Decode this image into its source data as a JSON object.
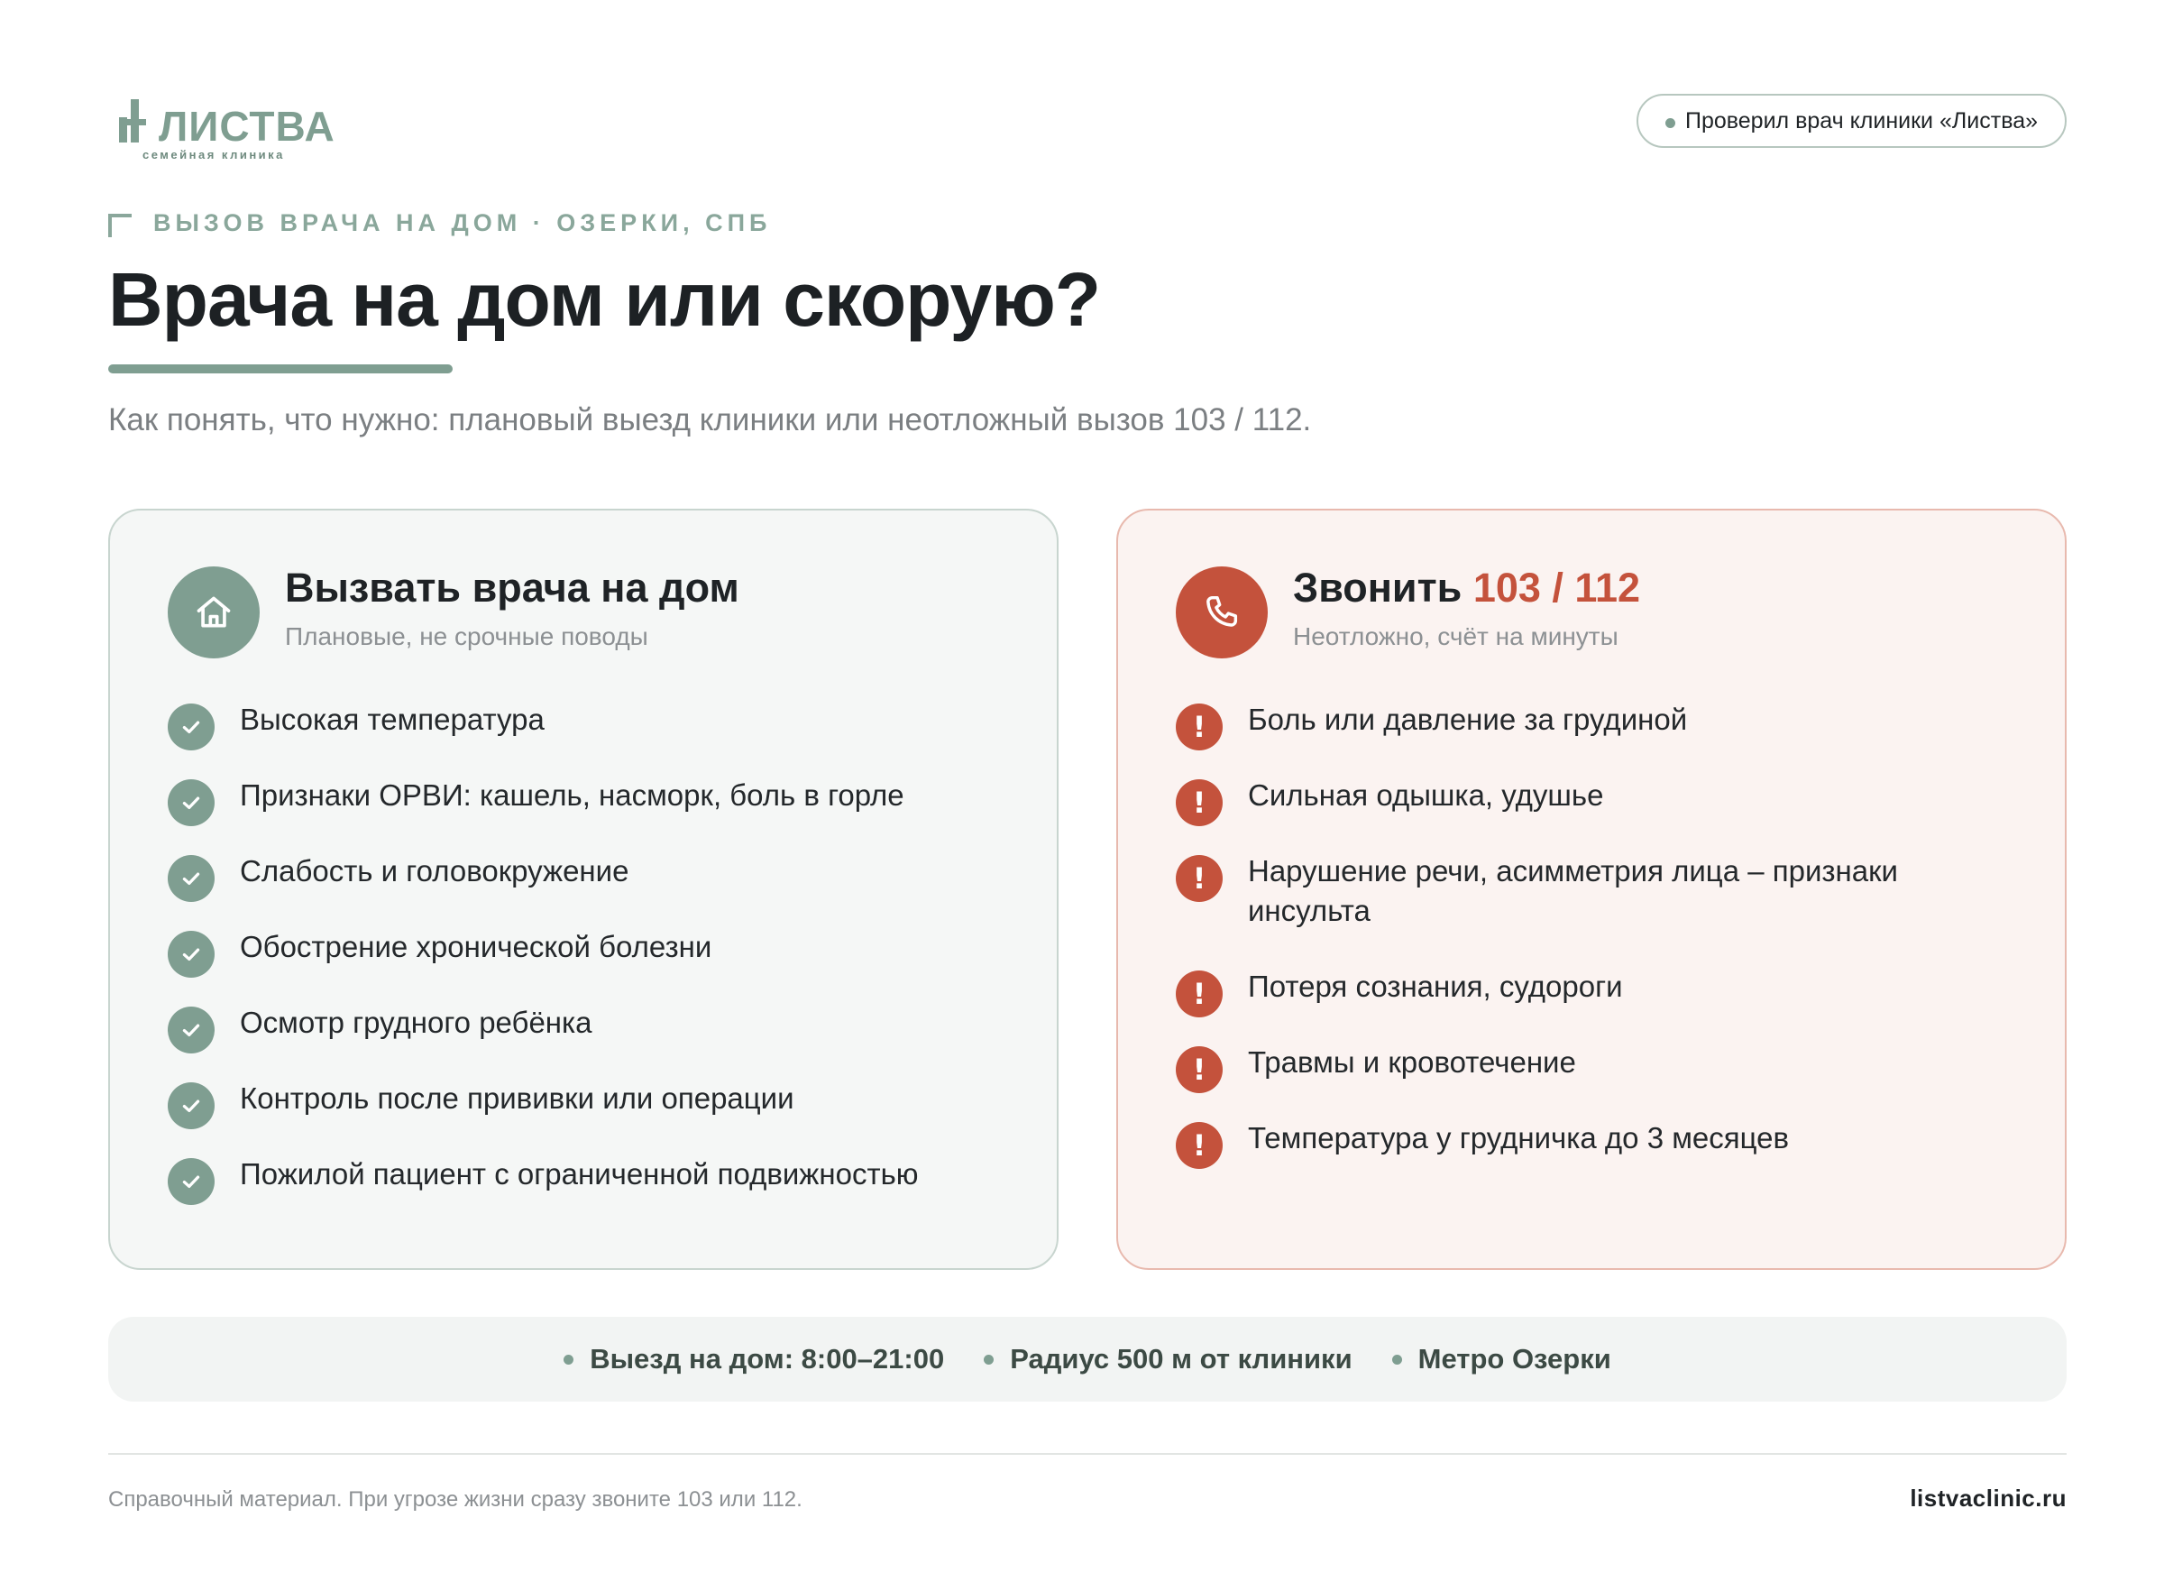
{
  "header": {
    "logo_text": "ЛИСТВА",
    "logo_subtitle": "семейная клиника",
    "verified_badge": "Проверил врач клиники «Листва»"
  },
  "eyebrow": "ВЫЗОВ ВРАЧА НА ДОМ · ОЗЕРКИ, СПБ",
  "title": "Врача на дом или скорую?",
  "subtitle": "Как понять, что нужно: плановый выезд клиники или неотложный вызов 103 / 112.",
  "home_card": {
    "icon": "house-icon",
    "title": "Вызвать врача на дом",
    "subtitle": "Плановые, не срочные поводы",
    "item_icon": "check-icon",
    "items": [
      "Высокая температура",
      "Признаки ОРВИ: кашель, насморк, боль в горле",
      "Слабость и головокружение",
      "Обострение хронической болезни",
      "Осмотр грудного ребёнка",
      "Контроль после прививки или операции",
      "Пожилой пациент с ограниченной подвижностью"
    ]
  },
  "urgent_card": {
    "icon": "phone-icon",
    "title_prefix": "Звонить",
    "title_accent": "103 / 112",
    "subtitle": "Неотложно, счёт на минуты",
    "item_icon": "exclamation-icon",
    "items": [
      "Боль или давление за грудиной",
      "Сильная одышка, удушье",
      "Нарушение речи, асимметрия лица – признаки инсульта",
      "Потеря сознания, судороги",
      "Травмы и кровотечение",
      "Температура у грудничка до 3 месяцев"
    ]
  },
  "infobar": {
    "hours": "Выезд на дом: 8:00–21:00",
    "radius": "Радиус 500 м от клиники",
    "metro": "Метро Озерки"
  },
  "footer": {
    "note": "Справочный материал. При угрозе жизни сразу звоните 103 или 112.",
    "site": "listvaclinic.ru"
  },
  "colors": {
    "brand_green": "#7f9e91",
    "urgent_red": "#c4523c",
    "text_dark": "#1f2326"
  }
}
